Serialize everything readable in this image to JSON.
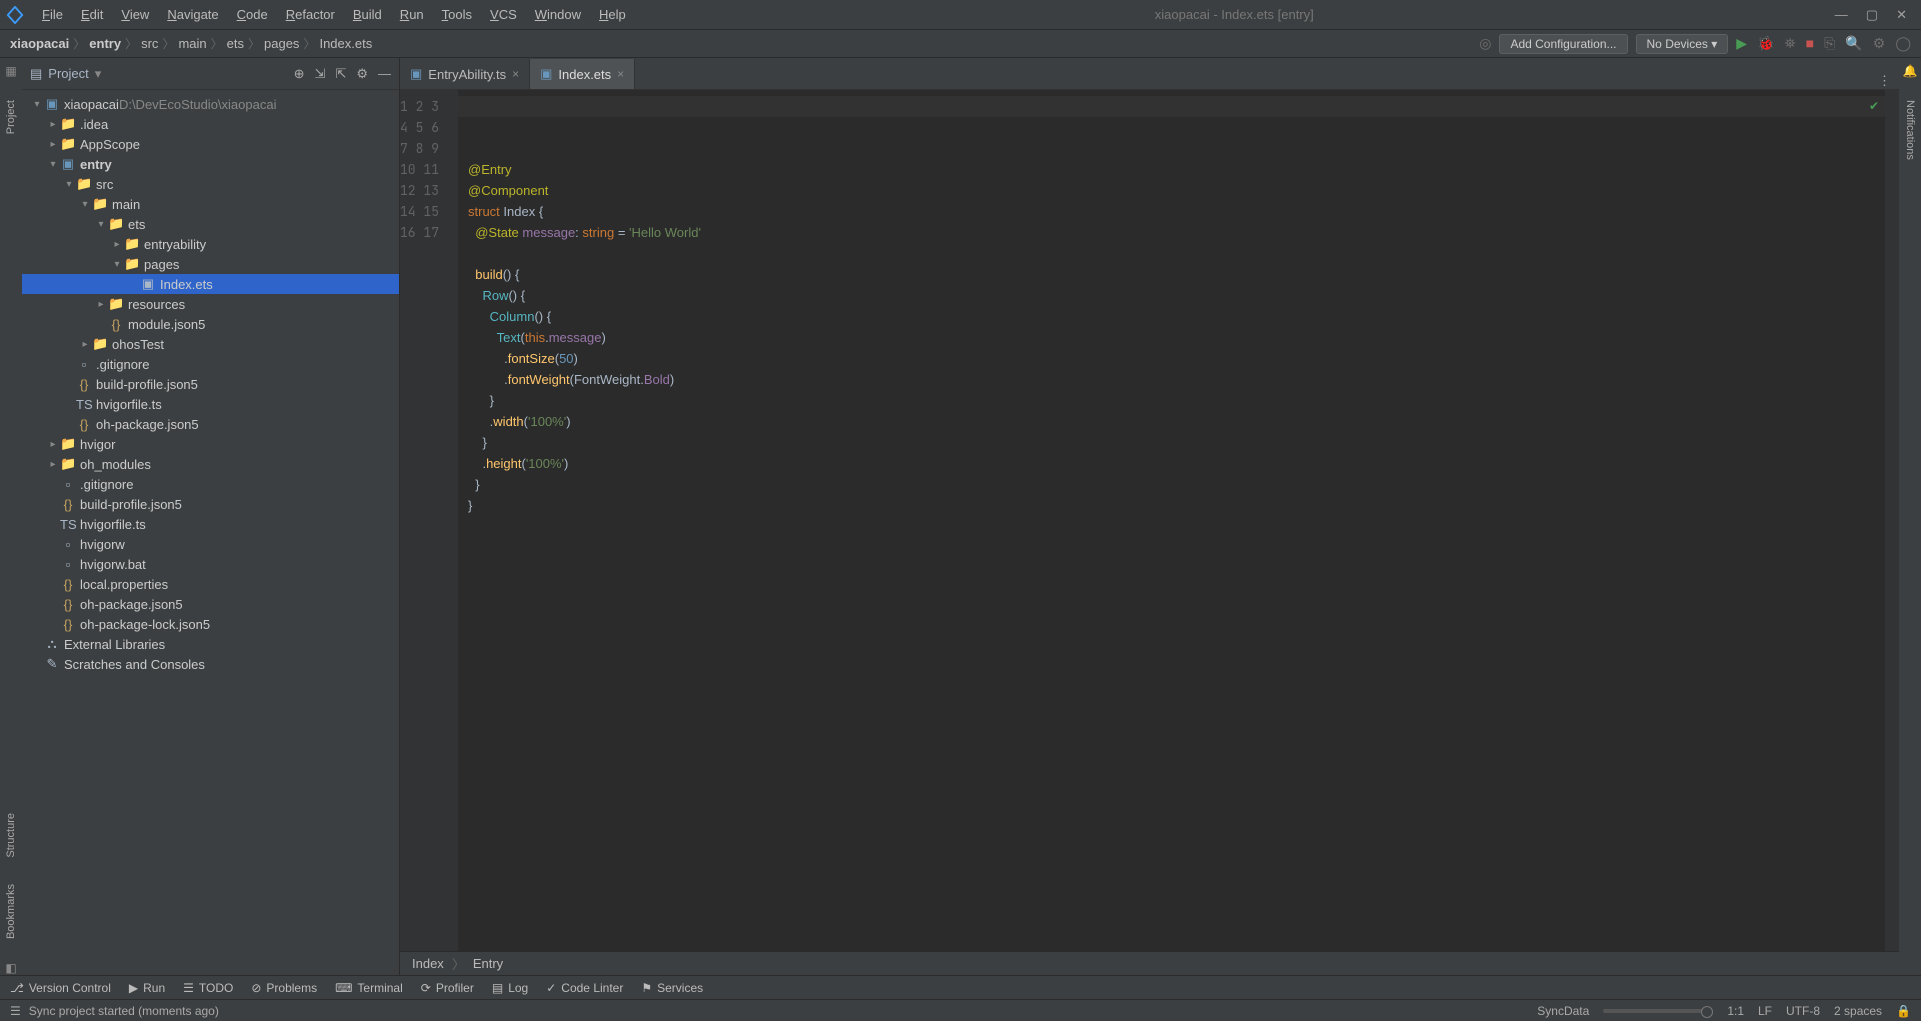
{
  "window": {
    "title": "xiaopacai - Index.ets [entry]"
  },
  "menu": [
    "File",
    "Edit",
    "View",
    "Navigate",
    "Code",
    "Refactor",
    "Build",
    "Run",
    "Tools",
    "VCS",
    "Window",
    "Help"
  ],
  "breadcrumbs": [
    "xiaopacai",
    "entry",
    "src",
    "main",
    "ets",
    "pages",
    "Index.ets"
  ],
  "run": {
    "add_config": "Add Configuration...",
    "device": "No Devices"
  },
  "project": {
    "label": "Project",
    "root": {
      "name": "xiaopacai",
      "path": "D:\\DevEcoStudio\\xiaopacai"
    },
    "tree_rows": [
      {
        "d": 0,
        "tw": "v",
        "ic": "mod",
        "text": "xiaopacai",
        "extra": "D:\\DevEcoStudio\\xiaopacai"
      },
      {
        "d": 1,
        "tw": ">",
        "ic": "folder",
        "text": ".idea"
      },
      {
        "d": 1,
        "tw": ">",
        "ic": "folder",
        "text": "AppScope"
      },
      {
        "d": 1,
        "tw": "v",
        "ic": "mod",
        "text": "entry",
        "bold": true
      },
      {
        "d": 2,
        "tw": "v",
        "ic": "folder",
        "text": "src"
      },
      {
        "d": 3,
        "tw": "v",
        "ic": "folder",
        "text": "main"
      },
      {
        "d": 4,
        "tw": "v",
        "ic": "folder",
        "text": "ets"
      },
      {
        "d": 5,
        "tw": ">",
        "ic": "folder",
        "text": "entryability"
      },
      {
        "d": 5,
        "tw": "v",
        "ic": "folder",
        "text": "pages"
      },
      {
        "d": 6,
        "tw": "",
        "ic": "ets",
        "text": "Index.ets",
        "selected": true
      },
      {
        "d": 4,
        "tw": ">",
        "ic": "folder",
        "text": "resources"
      },
      {
        "d": 4,
        "tw": "",
        "ic": "json",
        "text": "module.json5"
      },
      {
        "d": 3,
        "tw": ">",
        "ic": "folder",
        "text": "ohosTest"
      },
      {
        "d": 2,
        "tw": "",
        "ic": "file",
        "text": ".gitignore"
      },
      {
        "d": 2,
        "tw": "",
        "ic": "json",
        "text": "build-profile.json5"
      },
      {
        "d": 2,
        "tw": "",
        "ic": "ts",
        "text": "hvigorfile.ts"
      },
      {
        "d": 2,
        "tw": "",
        "ic": "json",
        "text": "oh-package.json5"
      },
      {
        "d": 1,
        "tw": ">",
        "ic": "folder",
        "text": "hvigor"
      },
      {
        "d": 1,
        "tw": ">",
        "ic": "folder",
        "text": "oh_modules"
      },
      {
        "d": 1,
        "tw": "",
        "ic": "file",
        "text": ".gitignore"
      },
      {
        "d": 1,
        "tw": "",
        "ic": "json",
        "text": "build-profile.json5"
      },
      {
        "d": 1,
        "tw": "",
        "ic": "ts",
        "text": "hvigorfile.ts"
      },
      {
        "d": 1,
        "tw": "",
        "ic": "file",
        "text": "hvigorw"
      },
      {
        "d": 1,
        "tw": "",
        "ic": "file",
        "text": "hvigorw.bat"
      },
      {
        "d": 1,
        "tw": "",
        "ic": "json",
        "text": "local.properties"
      },
      {
        "d": 1,
        "tw": "",
        "ic": "json",
        "text": "oh-package.json5"
      },
      {
        "d": 1,
        "tw": "",
        "ic": "json",
        "text": "oh-package-lock.json5"
      },
      {
        "d": 0,
        "tw": "",
        "ic": "lib",
        "text": "External Libraries"
      },
      {
        "d": 0,
        "tw": "",
        "ic": "scratch",
        "text": "Scratches and Consoles"
      }
    ]
  },
  "tabs": [
    {
      "name": "EntryAbility.ts",
      "active": false
    },
    {
      "name": "Index.ets",
      "active": true
    }
  ],
  "editor": {
    "lines": 17,
    "code_html": "<span class=\"dec\">@Entry</span>\n<span class=\"dec\">@Component</span>\n<span class=\"kw\">struct</span> <span class=\"cls\">Index</span> {\n  <span class=\"dec\">@State</span> <span class=\"prop\">message</span>: <span class=\"kw\">string</span> = <span class=\"str\">'Hello World'</span>\n\n  <span class=\"fn\">build</span>() {\n    <span class=\"call\">Row</span>() {\n      <span class=\"call\">Column</span>() {\n        <span class=\"call\">Text</span>(<span class=\"kw\">this</span>.<span class=\"prop\">message</span>)\n          .<span class=\"fn\">fontSize</span>(<span class=\"num\">50</span>)\n          .<span class=\"fn\">fontWeight</span>(FontWeight.<span class=\"id\">Bold</span>)\n      }\n      .<span class=\"fn\">width</span>(<span class=\"str\">'100%'</span>)\n    }\n    .<span class=\"fn\">height</span>(<span class=\"str\">'100%'</span>)\n  }\n}",
    "crumb": [
      "Index",
      "Entry"
    ]
  },
  "bottom_tools": [
    "Version Control",
    "Run",
    "TODO",
    "Problems",
    "Terminal",
    "Profiler",
    "Log",
    "Code Linter",
    "Services"
  ],
  "status": {
    "msg": "Sync project started (moments ago)",
    "sync": "SyncData",
    "pos": "1:1",
    "sep": "LF",
    "enc": "UTF-8",
    "indent": "2 spaces"
  },
  "rails": {
    "project": "Project",
    "structure": "Structure",
    "bookmarks": "Bookmarks",
    "notifications": "Notifications"
  }
}
